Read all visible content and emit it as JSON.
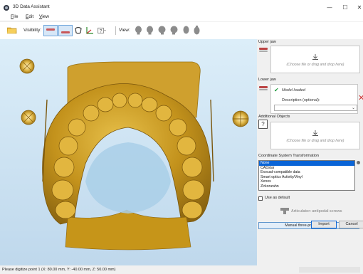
{
  "window": {
    "title": "3D Data Assistant",
    "minimize": "—",
    "maximize": "☐",
    "close": "✕"
  },
  "menu": {
    "file": "File",
    "edit": "Edit",
    "view": "View"
  },
  "toolbar": {
    "visibility_label": "Visibility:",
    "view_label": "View:"
  },
  "icons": {
    "app": "tooth-app-icon",
    "open": "folder-icon",
    "visibility": [
      "upper-jaw-visibility-icon",
      "lower-jaw-visibility-icon"
    ],
    "tools": [
      "occlusion-icon",
      "axis-icon",
      "help-box-icon"
    ],
    "views": [
      "front-view-icon",
      "back-view-icon",
      "left-view-icon",
      "right-view-icon",
      "top-view-icon",
      "bottom-view-icon"
    ]
  },
  "panel": {
    "upper_jaw_label": "Upper jaw",
    "upper_drop_text": "(Choose file or drag and drop here)",
    "lower_jaw_label": "Lower jaw",
    "model_loaded": "Model loaded",
    "description_label": "Description (optional):",
    "description_value": "",
    "additional_label": "Additional Objects",
    "additional_drop_text": "(Choose file or drag and drop here)",
    "coord_label": "Coordinate System Transformation",
    "coord_options": [
      "None",
      "CADstar",
      "Exocad-compatible data",
      "Smart optics Activity/Vinyl",
      "Xenos",
      "Zirkonzahn"
    ],
    "coord_selected": "None",
    "use_default": "Use as default",
    "articulator_label": "Articulator: antipodal screws",
    "manual_button": "Manual three-point alignment",
    "import_button": "Import",
    "cancel_button": "Cancel"
  },
  "status": {
    "text": "Please digitize point 1 (X: 80.00 mm, Y: -40.00 mm, Z: 50.00 mm)"
  },
  "colors": {
    "accent": "#0a64d6",
    "model_gold": "#c99a1e",
    "viewport_bg": "#cfe3f3",
    "success": "#1e9a3e",
    "error": "#d03030"
  }
}
